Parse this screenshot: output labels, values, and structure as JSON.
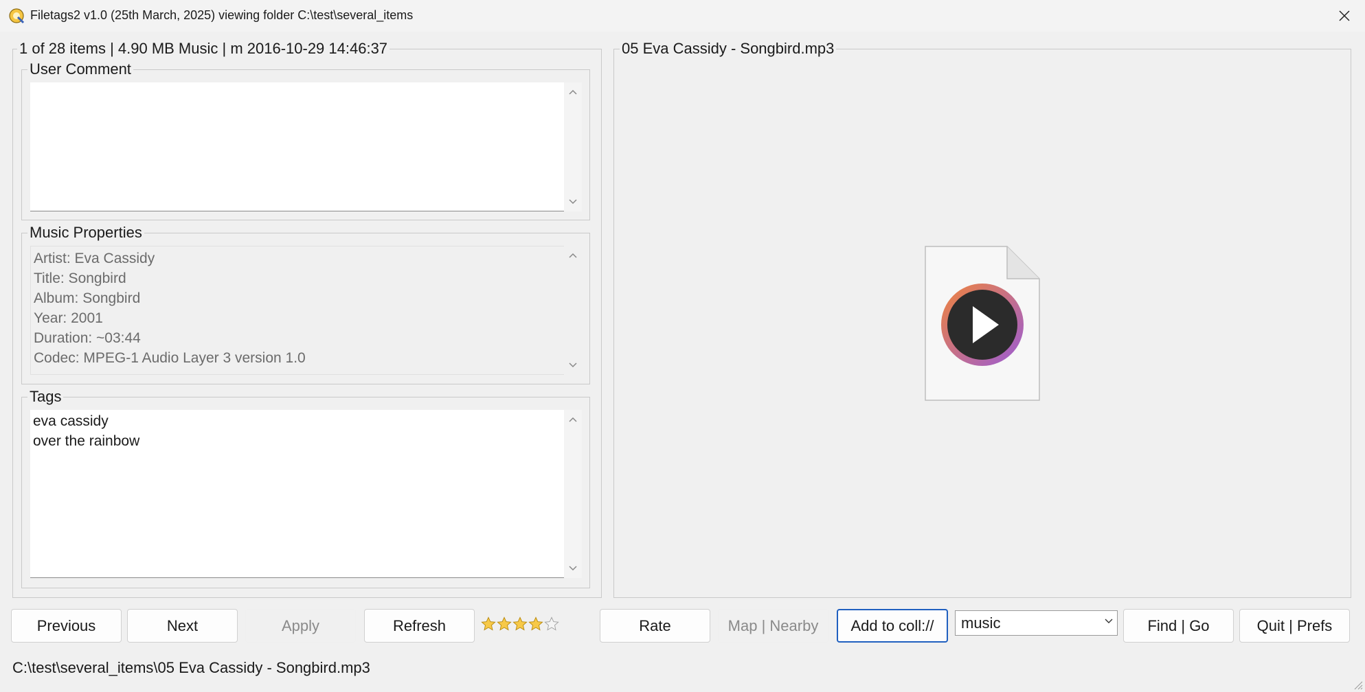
{
  "window": {
    "title": "Filetags2 v1.0 (25th March, 2025) viewing folder C:\\test\\several_items",
    "close_glyph": "✕"
  },
  "info_group": {
    "legend": "1 of 28 items | 4.90 MB Music | m 2016-10-29 14:46:37"
  },
  "user_comment": {
    "legend": "User Comment",
    "value": ""
  },
  "music_properties": {
    "legend": "Music Properties",
    "lines": [
      "Artist: Eva Cassidy",
      "Title: Songbird",
      "Album: Songbird",
      "Year: 2001",
      "Duration: ~03:44",
      "Codec: MPEG-1 Audio Layer 3 version 1.0"
    ]
  },
  "tags": {
    "legend": "Tags",
    "lines": [
      "eva cassidy",
      "over the rainbow"
    ]
  },
  "preview": {
    "legend": "05 Eva Cassidy - Songbird.mp3",
    "icon": "audio-file-icon"
  },
  "buttons": {
    "previous": "Previous",
    "next": "Next",
    "apply": "Apply",
    "refresh": "Refresh",
    "rate": "Rate",
    "map_nearby": "Map | Nearby",
    "add_to_coll": "Add to coll://",
    "find_go": "Find | Go",
    "quit_prefs": "Quit | Prefs"
  },
  "rating": {
    "value": 4,
    "max": 5
  },
  "collection_combo": {
    "selected": "music"
  },
  "status": {
    "path": "C:\\test\\several_items\\05 Eva Cassidy - Songbird.mp3"
  },
  "colors": {
    "star_fill": "#f7c948",
    "focus_border": "#1f5fbf",
    "play_ring_start": "#f0843c",
    "play_ring_end": "#9a5bd6"
  }
}
